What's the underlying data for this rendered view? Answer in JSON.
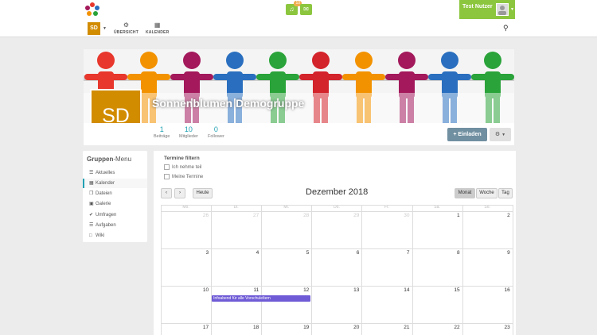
{
  "header": {
    "notif_badge": "10",
    "user_name": "Test Nutzer",
    "space_initials": "SD",
    "nav": [
      {
        "label": "ÜBERSICHT",
        "icon": "dashboard-icon"
      },
      {
        "label": "KALENDER",
        "icon": "calendar-icon"
      }
    ]
  },
  "group": {
    "name": "Sonnenblumen Demogruppe",
    "initials": "SD",
    "stats": [
      {
        "value": "1",
        "label": "Beiträge"
      },
      {
        "value": "10",
        "label": "Mitglieder"
      },
      {
        "value": "0",
        "label": "Follower"
      }
    ],
    "invite_label": "Einladen",
    "banner_colors": [
      "#e8372c",
      "#f39200",
      "#a3195b",
      "#2a6fbf",
      "#2aa33a",
      "#d3232b",
      "#f39200",
      "#a3195b",
      "#2a6fbf",
      "#2aa33a"
    ]
  },
  "sidebar": {
    "title_bold": "Gruppen",
    "title_rest": "-Menu",
    "items": [
      {
        "label": "Aktuelles",
        "icon": "list-icon"
      },
      {
        "label": "Kalender",
        "icon": "calendar-icon"
      },
      {
        "label": "Dateien",
        "icon": "files-icon"
      },
      {
        "label": "Galerie",
        "icon": "image-icon"
      },
      {
        "label": "Umfragen",
        "icon": "poll-icon"
      },
      {
        "label": "Aufgaben",
        "icon": "tasks-icon"
      },
      {
        "label": "Wiki",
        "icon": "book-icon"
      }
    ]
  },
  "filter": {
    "title": "Termine filtern",
    "options": [
      "Ich nehme teil",
      "Meine Termine"
    ]
  },
  "calendar": {
    "today_label": "Heute",
    "title": "Dezember 2018",
    "views": [
      "Monat",
      "Woche",
      "Tag"
    ],
    "weekdays": [
      "Mo.",
      "Di.",
      "Mi.",
      "Do.",
      "Fr.",
      "Sa.",
      "So."
    ],
    "weeks": [
      [
        "26",
        "27",
        "28",
        "29",
        "30",
        "1",
        "2"
      ],
      [
        "3",
        "4",
        "5",
        "6",
        "7",
        "8",
        "9"
      ],
      [
        "10",
        "11",
        "12",
        "13",
        "14",
        "15",
        "16"
      ],
      [
        "17",
        "18",
        "19",
        "20",
        "21",
        "22",
        "23"
      ]
    ],
    "event_title": "Infoabend für alle Vorschuleltern",
    "event_color": "#6f5bd6"
  }
}
